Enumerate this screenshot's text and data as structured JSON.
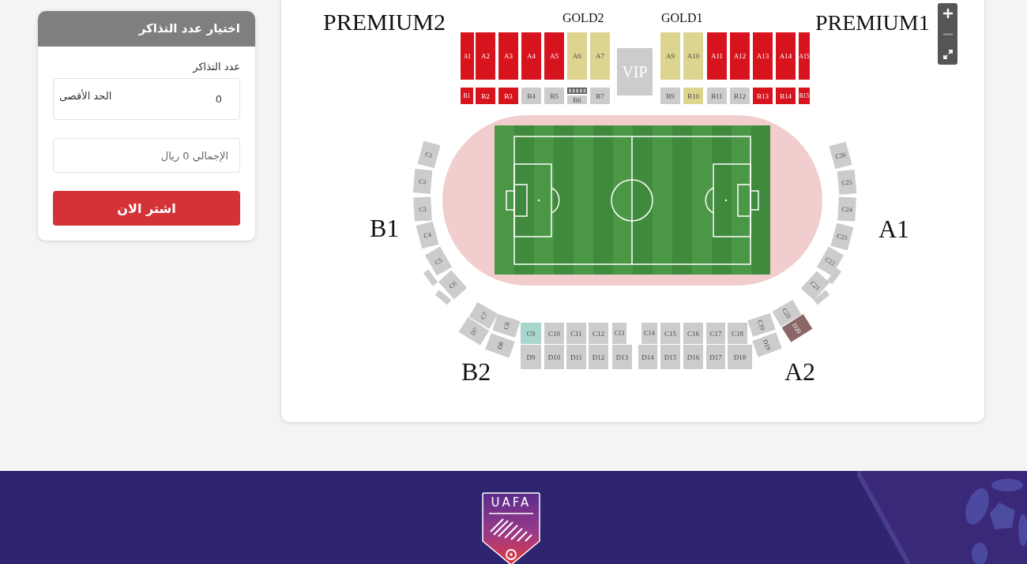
{
  "ticket_panel": {
    "title": "اختيار عدد التذاكر",
    "count_label": "عدد التذاكر",
    "count_value": "0",
    "max_label": "الحد الأقصى",
    "total_placeholder": "الإجمالي 0 ريال",
    "buy_button": "اشتر الان"
  },
  "stadium_map": {
    "zone_labels": [
      "PREMIUM2",
      "GOLD2",
      "GOLD1",
      "PREMIUM1",
      "B1",
      "A1",
      "B2",
      "A2"
    ],
    "sections": [
      {
        "label": "A1",
        "color": "#d7141e"
      },
      {
        "label": "A2",
        "color": "#d7141e"
      },
      {
        "label": "A3",
        "color": "#d7141e"
      },
      {
        "label": "A4",
        "color": "#d7141e"
      },
      {
        "label": "A5",
        "color": "#d7141e"
      },
      {
        "label": "A6",
        "color": "#ddd48f"
      },
      {
        "label": "A7",
        "color": "#ddd48f"
      },
      {
        "label": "VIP",
        "color": "#cccccc"
      },
      {
        "label": "A9",
        "color": "#ddd48f"
      },
      {
        "label": "A10",
        "color": "#ddd48f"
      },
      {
        "label": "A11",
        "color": "#d7141e"
      },
      {
        "label": "A12",
        "color": "#d7141e"
      },
      {
        "label": "A13",
        "color": "#d7141e"
      },
      {
        "label": "A14",
        "color": "#d7141e"
      },
      {
        "label": "A15",
        "color": "#d7141e"
      },
      {
        "label": "B1",
        "color": "#d7141e"
      },
      {
        "label": "B2",
        "color": "#d7141e"
      },
      {
        "label": "B3",
        "color": "#d7141e"
      },
      {
        "label": "B4",
        "color": "#cccccc"
      },
      {
        "label": "B5",
        "color": "#cccccc"
      },
      {
        "label": "B6",
        "color": "#cccccc"
      },
      {
        "label": "B7",
        "color": "#cccccc"
      },
      {
        "label": "B9",
        "color": "#cccccc"
      },
      {
        "label": "B10",
        "color": "#ddd48f"
      },
      {
        "label": "B11",
        "color": "#cccccc"
      },
      {
        "label": "B12",
        "color": "#cccccc"
      },
      {
        "label": "B13",
        "color": "#d7141e"
      },
      {
        "label": "B14",
        "color": "#d7141e"
      },
      {
        "label": "B15",
        "color": "#d7141e"
      },
      {
        "label": "C1",
        "color": "#cccccc"
      },
      {
        "label": "C2",
        "color": "#cccccc"
      },
      {
        "label": "C3",
        "color": "#cccccc"
      },
      {
        "label": "C4",
        "color": "#cccccc"
      },
      {
        "label": "C5",
        "color": "#cccccc"
      },
      {
        "label": "C6",
        "color": "#cccccc"
      },
      {
        "label": "C7",
        "color": "#cccccc"
      },
      {
        "label": "C8",
        "color": "#cccccc"
      },
      {
        "label": "C9",
        "color": "#a8d5cc"
      },
      {
        "label": "C10",
        "color": "#cccccc"
      },
      {
        "label": "C11",
        "color": "#cccccc"
      },
      {
        "label": "C12",
        "color": "#cccccc"
      },
      {
        "label": "C13",
        "color": "#cccccc"
      },
      {
        "label": "C14",
        "color": "#cccccc"
      },
      {
        "label": "C15",
        "color": "#cccccc"
      },
      {
        "label": "C16",
        "color": "#cccccc"
      },
      {
        "label": "C17",
        "color": "#cccccc"
      },
      {
        "label": "C18",
        "color": "#cccccc"
      },
      {
        "label": "C19",
        "color": "#cccccc"
      },
      {
        "label": "C20",
        "color": "#cccccc"
      },
      {
        "label": "C21",
        "color": "#cccccc"
      },
      {
        "label": "C22",
        "color": "#cccccc"
      },
      {
        "label": "C23",
        "color": "#cccccc"
      },
      {
        "label": "C24",
        "color": "#cccccc"
      },
      {
        "label": "C25",
        "color": "#cccccc"
      },
      {
        "label": "C26",
        "color": "#cccccc"
      },
      {
        "label": "D7",
        "color": "#cccccc"
      },
      {
        "label": "D8",
        "color": "#cccccc"
      },
      {
        "label": "D9",
        "color": "#cccccc"
      },
      {
        "label": "D10",
        "color": "#cccccc"
      },
      {
        "label": "D11",
        "color": "#cccccc"
      },
      {
        "label": "D12",
        "color": "#cccccc"
      },
      {
        "label": "D13",
        "color": "#cccccc"
      },
      {
        "label": "D14",
        "color": "#cccccc"
      },
      {
        "label": "D15",
        "color": "#cccccc"
      },
      {
        "label": "D16",
        "color": "#cccccc"
      },
      {
        "label": "D17",
        "color": "#cccccc"
      },
      {
        "label": "D18",
        "color": "#cccccc"
      },
      {
        "label": "D19",
        "color": "#cccccc"
      },
      {
        "label": "D20",
        "color": "#8b6666"
      },
      {
        "color": "#cccccc"
      },
      {
        "color": "#cccccc"
      },
      {
        "color": "#cccccc"
      },
      {
        "color": "#cccccc"
      }
    ]
  },
  "footer": {
    "logo_text": "UAFA"
  }
}
